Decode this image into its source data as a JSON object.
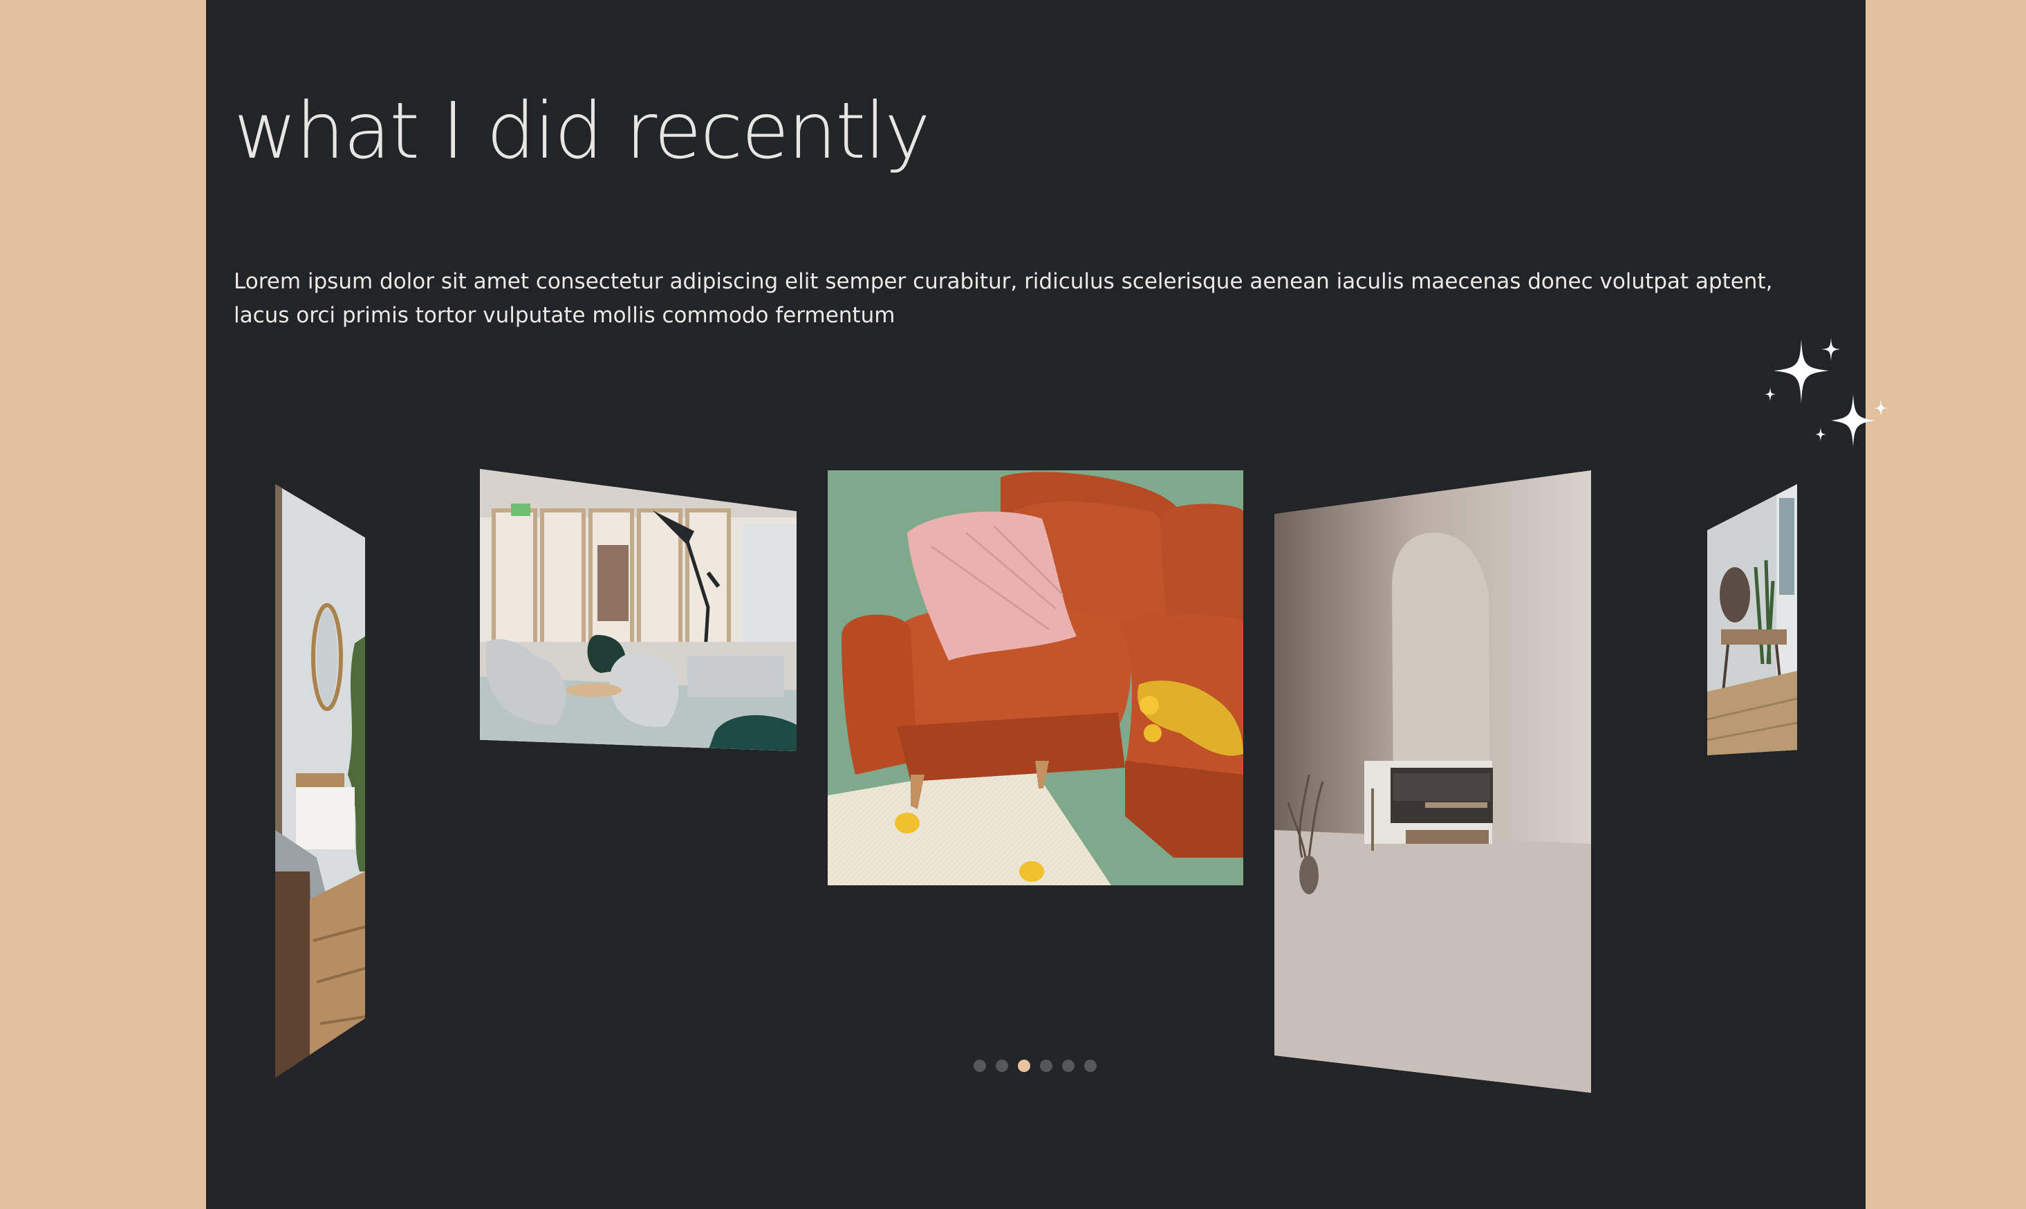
{
  "section": {
    "title": "what I did recently",
    "description": "Lorem ipsum dolor sit amet consectetur adipiscing elit semper curabitur, ridiculus scelerisque aenean iaculis maecenas donec volutpat aptent, lacus orci primis tortor vulputate mollis commodo fermentum"
  },
  "colors": {
    "page_background": "#e0c09f",
    "panel_background": "#232427",
    "accent": "#e9c3a0",
    "dot_inactive": "#55575b"
  },
  "carousel": {
    "active_index": 3,
    "slide_count": 6,
    "slides": [
      {
        "subject": "bedroom-with-mirror-and-plant"
      },
      {
        "subject": "lounge-with-armchairs-and-floor-lamp"
      },
      {
        "subject": "orange-sofa-with-pink-pillow"
      },
      {
        "subject": "arched-hallway-to-living-room"
      },
      {
        "subject": "entryway-with-console-table"
      }
    ]
  },
  "decorations": {
    "sparkles_icon": "sparkles-icon"
  }
}
